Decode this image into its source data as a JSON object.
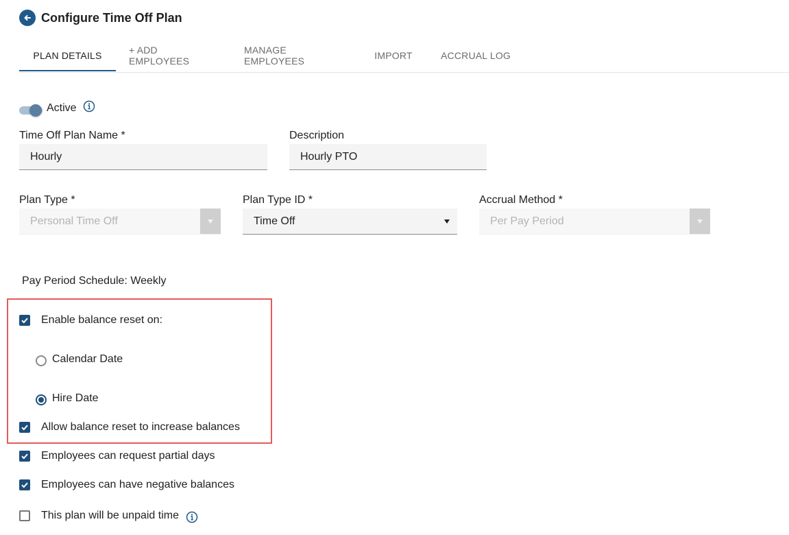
{
  "page": {
    "title": "Configure Time Off Plan",
    "back_icon": "arrow-left-icon"
  },
  "tabs": [
    {
      "label": "PLAN DETAILS",
      "active": true
    },
    {
      "label": "+ ADD EMPLOYEES",
      "active": false
    },
    {
      "label": "MANAGE EMPLOYEES",
      "active": false
    },
    {
      "label": "IMPORT",
      "active": false
    },
    {
      "label": "ACCRUAL LOG",
      "active": false
    }
  ],
  "active_toggle": {
    "label": "Active",
    "on": true,
    "info_icon": "info-icon"
  },
  "fields": {
    "plan_name": {
      "label": "Time Off Plan Name *",
      "value": "Hourly"
    },
    "description": {
      "label": "Description",
      "value": "Hourly PTO"
    },
    "plan_type": {
      "label": "Plan Type *",
      "value": "Personal Time Off",
      "disabled": true
    },
    "plan_type_id": {
      "label": "Plan Type ID *",
      "value": "Time Off",
      "disabled": false
    },
    "accrual_method": {
      "label": "Accrual Method *",
      "value": "Per Pay Period",
      "disabled": true
    }
  },
  "pay_period_schedule": "Pay Period Schedule: Weekly",
  "balance_reset": {
    "enable_label": "Enable balance reset on:",
    "enable_checked": true,
    "options": [
      {
        "label": "Calendar Date",
        "selected": false
      },
      {
        "label": "Hire Date",
        "selected": true
      }
    ],
    "allow_increase_label": "Allow balance reset to increase balances",
    "allow_increase_checked": true
  },
  "options": {
    "partial_days": {
      "label": "Employees can request partial days",
      "checked": true
    },
    "negative_balances": {
      "label": "Employees can have negative balances",
      "checked": true
    },
    "unpaid_time": {
      "label": "This plan will be unpaid time",
      "checked": false,
      "info_icon": "info-icon"
    }
  },
  "colors": {
    "accent": "#1f5a8a",
    "checkbox": "#1f4e7a",
    "highlight": "#e25b5b"
  }
}
